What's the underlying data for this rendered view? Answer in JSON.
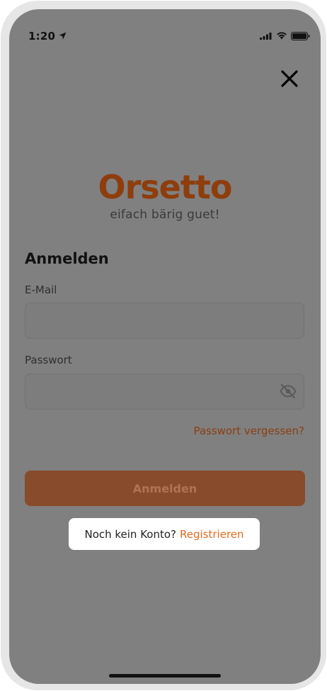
{
  "status_bar": {
    "time": "1:20"
  },
  "icons": {
    "location": "location-arrow-icon",
    "signal": "cellular-signal-icon",
    "wifi": "wifi-icon",
    "battery": "battery-icon",
    "close": "close-icon",
    "visibility": "eye-off-icon"
  },
  "brand": {
    "logo_text": "Orsetto",
    "tagline": "eifach bärig guet!",
    "color": "#8e3d0c"
  },
  "login": {
    "title": "Anmelden",
    "email_label": "E-Mail",
    "email_value": "",
    "email_placeholder": "",
    "password_label": "Passwort",
    "password_value": "",
    "password_placeholder": "",
    "forgot_label": "Passwort vergessen?",
    "submit_label": "Anmelden"
  },
  "register": {
    "prompt": "Noch kein Konto?",
    "link": "Registrieren"
  },
  "colors": {
    "overlay": "#808080",
    "accent": "#e46a1d",
    "button": "#884b2b"
  }
}
